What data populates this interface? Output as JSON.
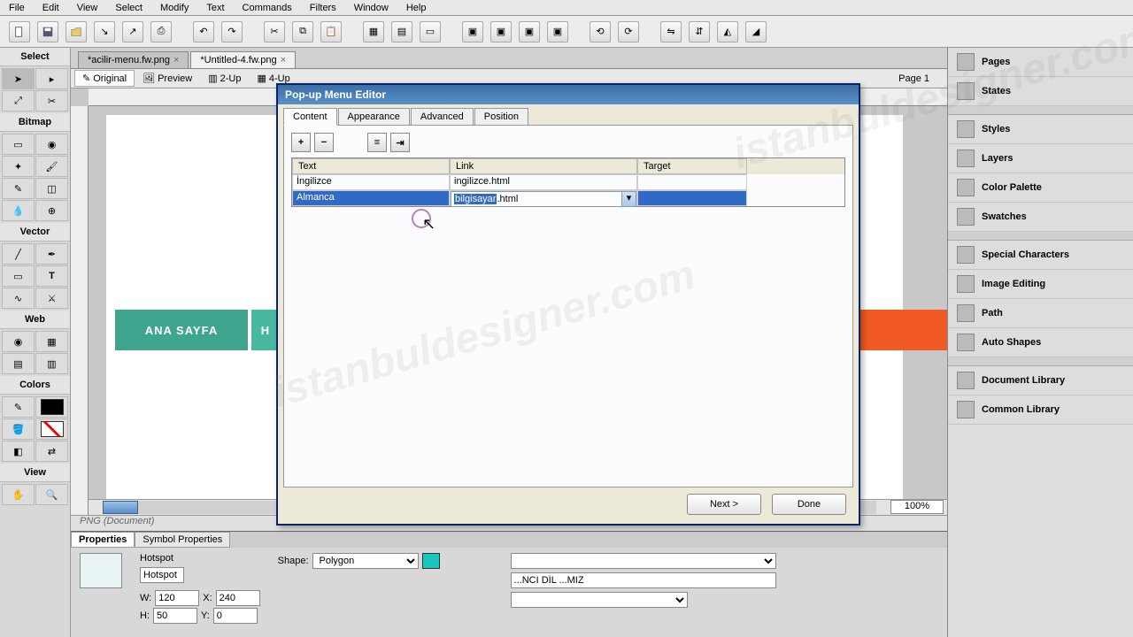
{
  "menubar": {
    "items": [
      "File",
      "Edit",
      "View",
      "Select",
      "Modify",
      "Text",
      "Commands",
      "Filters",
      "Window",
      "Help"
    ]
  },
  "doc_tabs": [
    {
      "name": "*acilir-menu.fw.png",
      "active": false
    },
    {
      "name": "*Untitled-4.fw.png",
      "active": true
    }
  ],
  "view_tabs": {
    "original": "Original",
    "preview": "Preview",
    "two_up": "2-Up",
    "four_up": "4-Up"
  },
  "page_indicator": "Page 1",
  "left_panel": {
    "select": "Select",
    "bitmap": "Bitmap",
    "vector": "Vector",
    "web": "Web",
    "colors": "Colors",
    "view": "View"
  },
  "canvas": {
    "nav1": "ANA SAYFA",
    "nav2_partial": "H",
    "status": "PNG (Document)"
  },
  "scroll": {
    "zoom": "100%"
  },
  "right_panel": {
    "pages": "Pages",
    "states": "States",
    "styles": "Styles",
    "layers": "Layers",
    "color_palette": "Color Palette",
    "swatches": "Swatches",
    "special_chars": "Special Characters",
    "image_editing": "Image Editing",
    "path": "Path",
    "auto_shapes": "Auto Shapes",
    "doc_library": "Document Library",
    "common_library": "Common Library"
  },
  "properties": {
    "tabs": {
      "properties": "Properties",
      "symbol": "Symbol Properties"
    },
    "hotspot_label": "Hotspot",
    "hotspot_value": "Hotspot",
    "shape_label": "Shape:",
    "shape_value": "Polygon",
    "w_label": "W:",
    "w_value": "120",
    "h_label": "H:",
    "h_value": "50",
    "x_label": "X:",
    "x_value": "240",
    "y_label": "Y:",
    "y_value": "0",
    "alt_partial": "...NCI DİL ...MIZ",
    "color_swatch": "#19c7c0"
  },
  "popup": {
    "title": "Pop-up Menu Editor",
    "tabs": {
      "content": "Content",
      "appearance": "Appearance",
      "advanced": "Advanced",
      "position": "Position"
    },
    "columns": {
      "text": "Text",
      "link": "Link",
      "target": "Target"
    },
    "rows": [
      {
        "text": "İngilizce",
        "link": "ingilizce.html",
        "target": "",
        "selected": false
      },
      {
        "text": "Almanca",
        "link": "bilgisayar.html",
        "link_selected_part": "bilgisayar",
        "target": "",
        "selected": true
      }
    ],
    "buttons": {
      "next": "Next  >",
      "done": "Done"
    }
  },
  "watermark": "istanbuldesigner.com"
}
